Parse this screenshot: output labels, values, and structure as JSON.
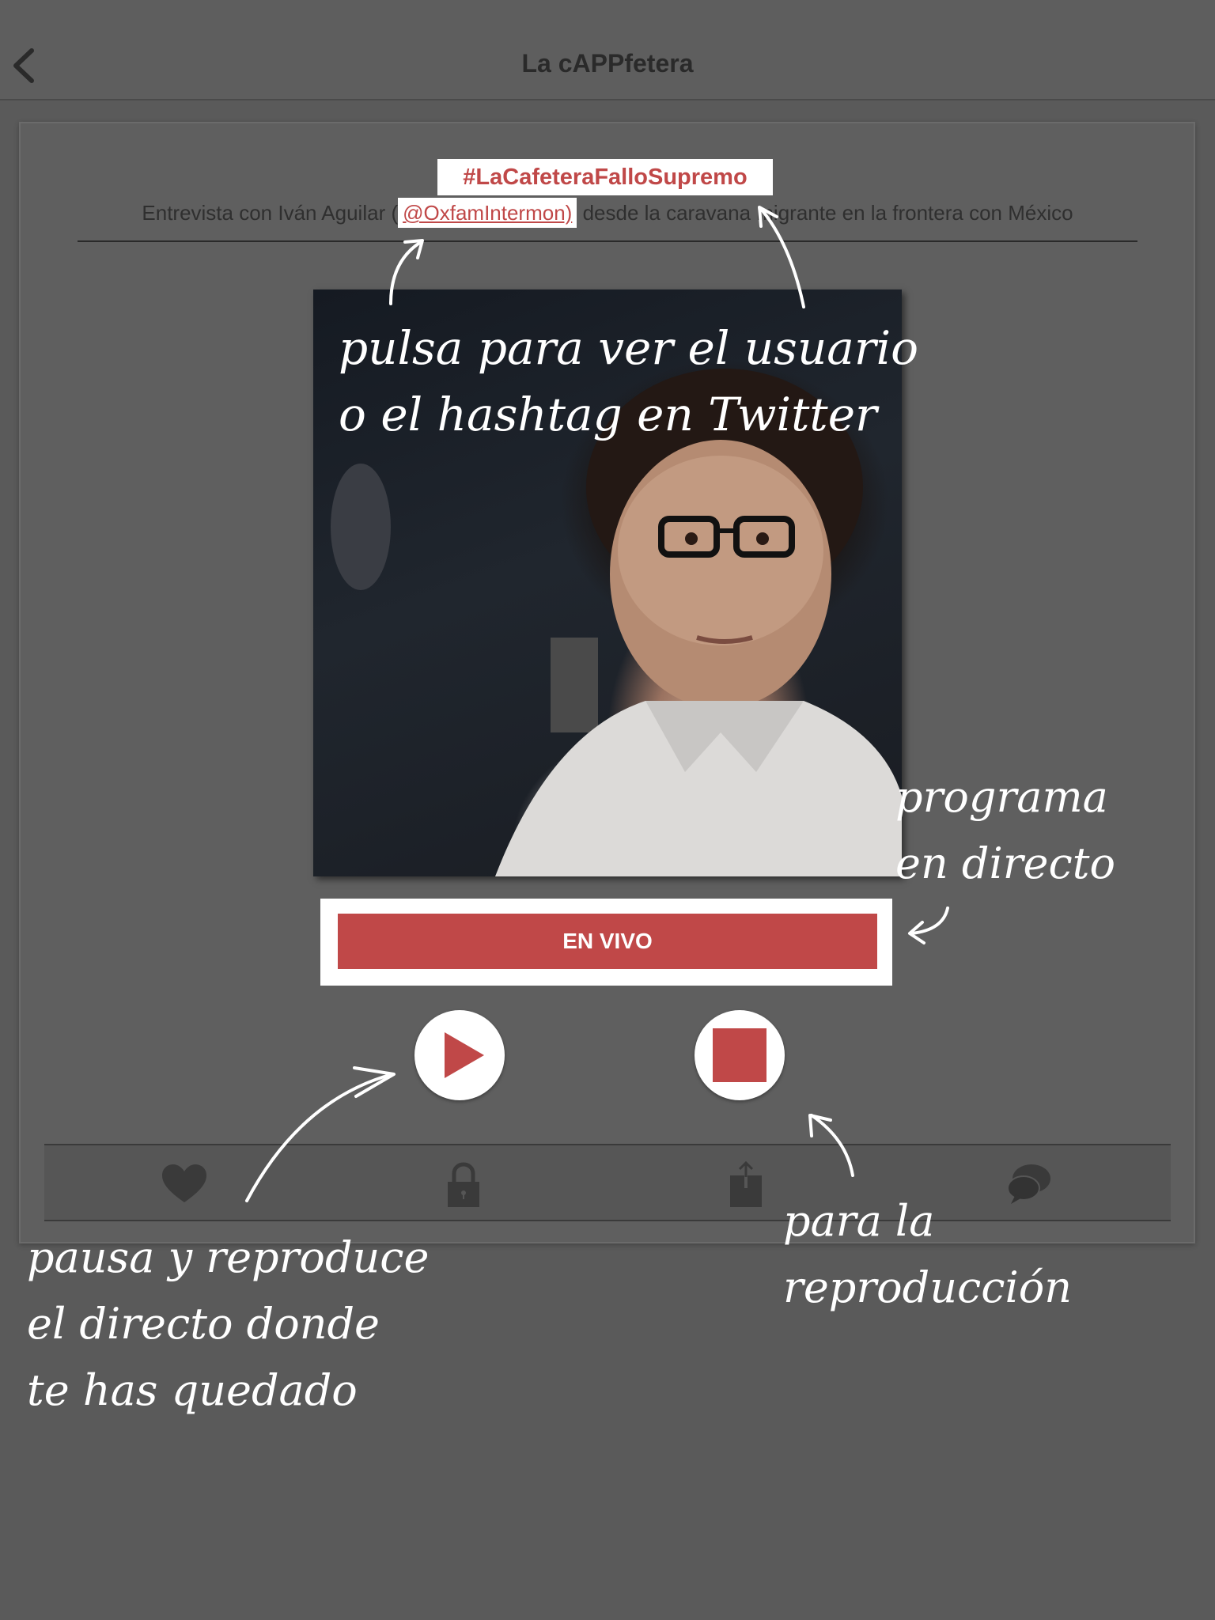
{
  "navbar": {
    "title": "La cAPPfetera",
    "back_icon": "chevron-left-icon"
  },
  "episode": {
    "hashtag": "#LaCafeteraFalloSupremo",
    "description_before": "Entrevista con Iván Aguilar (",
    "mention": "@OxfamIntermon)",
    "description_after": " desde la caravana migrante en la frontera con México"
  },
  "player": {
    "live_label": "EN VIVO",
    "play_icon": "play-icon",
    "stop_icon": "stop-icon",
    "accent_color": "#c04848"
  },
  "toolbar": {
    "icons": [
      "heart-icon",
      "lock-icon",
      "share-icon",
      "chat-icon"
    ]
  },
  "annotations": {
    "twitter_hint": "pulsa para ver el usuario\no el hashtag en Twitter",
    "live_hint": "programa\nen directo",
    "play_hint": "pausa y reproduce\nel directo donde\nte has quedado",
    "stop_hint": "para la\nreproducción"
  }
}
